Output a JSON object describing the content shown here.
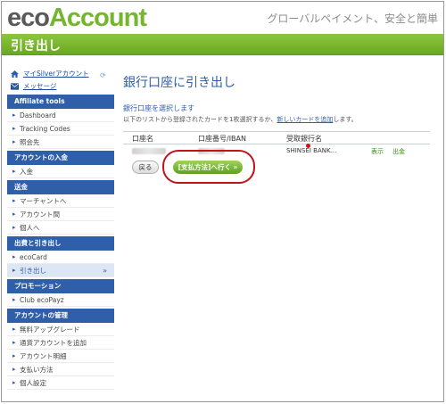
{
  "header": {
    "logo_eco": "eco",
    "logo_account": "Account",
    "tagline": "グローバルペイメント、安全と簡単",
    "page_heading": "引き出し"
  },
  "sidebar": {
    "top_links": [
      {
        "label": "マイSilverアカウント",
        "icon": "home-icon"
      },
      {
        "label": "メッセージ",
        "icon": "mail-icon"
      }
    ],
    "sections": [
      {
        "title": "Affiliate tools",
        "items": [
          "Dashboard",
          "Tracking Codes",
          "照会先"
        ]
      },
      {
        "title": "アカウントの入金",
        "items": [
          "入金"
        ]
      },
      {
        "title": "送金",
        "items": [
          "マーチャントへ",
          "アカウント間",
          "個人へ"
        ]
      },
      {
        "title": "出費と引き出し",
        "items": [
          "ecoCard",
          "引き出し"
        ]
      },
      {
        "title": "プロモーション",
        "items": [
          "Club ecoPayz"
        ]
      },
      {
        "title": "アカウントの管理",
        "items": [
          "無料アップグレード",
          "通貨アカウントを追加",
          "アカウント明細",
          "支払い方法",
          "個人設定"
        ]
      }
    ],
    "active_item": "引き出し"
  },
  "main": {
    "title": "銀行口座に引き出し",
    "subtitle": "銀行口座を選択します",
    "description_prefix": "以下のリストから登録されたカードを1枚選択するか、",
    "description_link": "新しいカードを追加",
    "description_suffix": "します。",
    "table": {
      "headers": [
        "口座名",
        "口座番号/IBAN",
        "受取銀行名"
      ],
      "rows": [
        {
          "bank": "SHINSEI BANK...",
          "show": "表示",
          "delete": "出金"
        }
      ]
    },
    "back_button": "戻る",
    "proceed_button": "[支払方法]へ行く »"
  },
  "colors": {
    "brand_green": "#74b62e",
    "nav_blue": "#2f5fa8",
    "highlight_red": "#c0141c"
  }
}
